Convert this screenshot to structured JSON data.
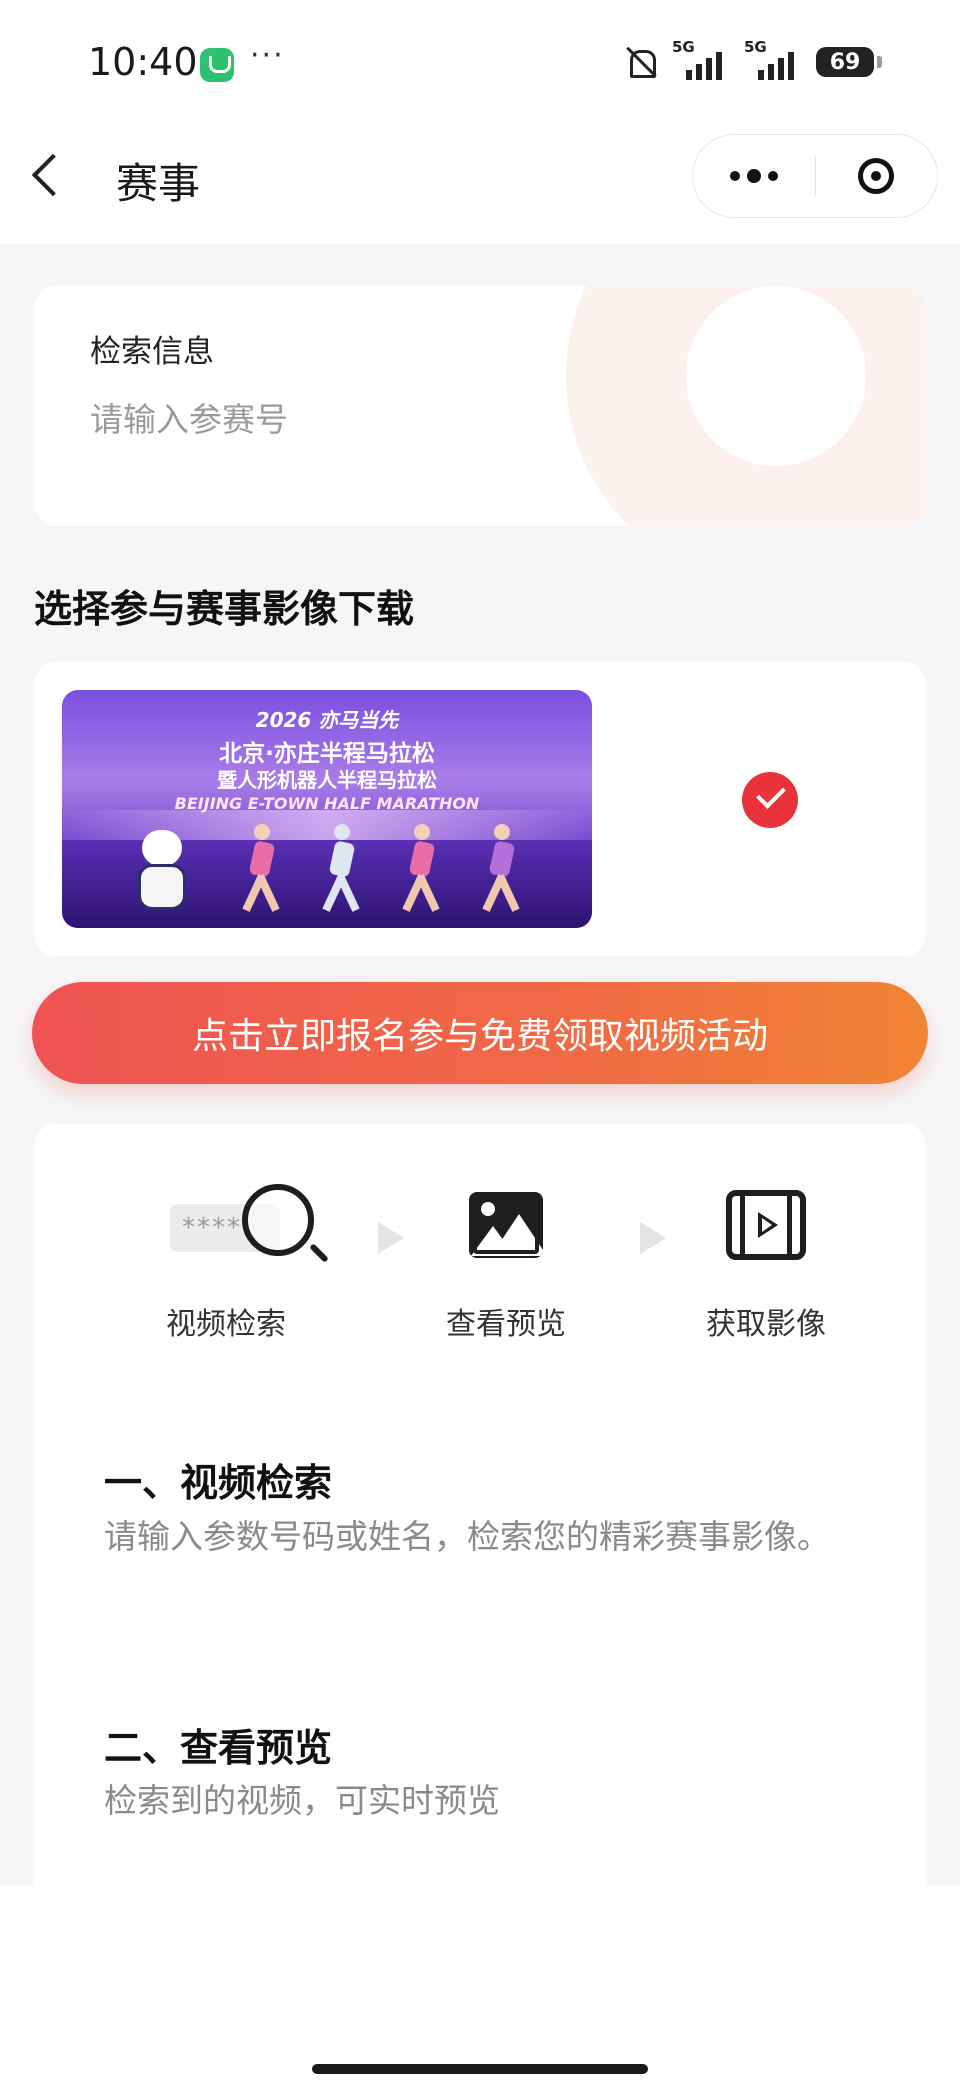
{
  "status_bar": {
    "time": "10:40",
    "more": "···",
    "network1": "5G",
    "network2": "5G",
    "battery": "69",
    "icons": [
      "wechat-icon",
      "bell-off-icon",
      "signal-icon",
      "battery-icon"
    ]
  },
  "nav": {
    "title": "赛事",
    "back_icon": "chevron-left-icon",
    "more_icon": "more-dots-icon",
    "close_icon": "target-icon"
  },
  "search": {
    "label": "检索信息",
    "placeholder": "请输入参赛号",
    "value": ""
  },
  "section_title": "选择参与赛事影像下载",
  "event_banner": {
    "line1": "2026 亦马当先",
    "line2": "北京·亦庄半程马拉松",
    "line3": "暨人形机器人半程马拉松",
    "line4": "BEIJING E-TOWN HALF MARATHON",
    "selected": true,
    "accent": "#e8323c"
  },
  "cta": {
    "label": "点击立即报名参与免费领取视频活动",
    "gradient_start": "#ef5353",
    "gradient_end": "#f18434"
  },
  "steps": [
    {
      "label": "视频检索",
      "icon": "magnifier-icon",
      "pill_text": "****"
    },
    {
      "label": "查看预览",
      "icon": "image-icon"
    },
    {
      "label": "获取影像",
      "icon": "video-film-icon"
    }
  ],
  "instructions": [
    {
      "heading": "一、视频检索",
      "text": "请输入参数号码或姓名，检索您的精彩赛事影像。"
    },
    {
      "heading": "二、查看预览",
      "text": "检索到的视频，可实时预览"
    }
  ]
}
